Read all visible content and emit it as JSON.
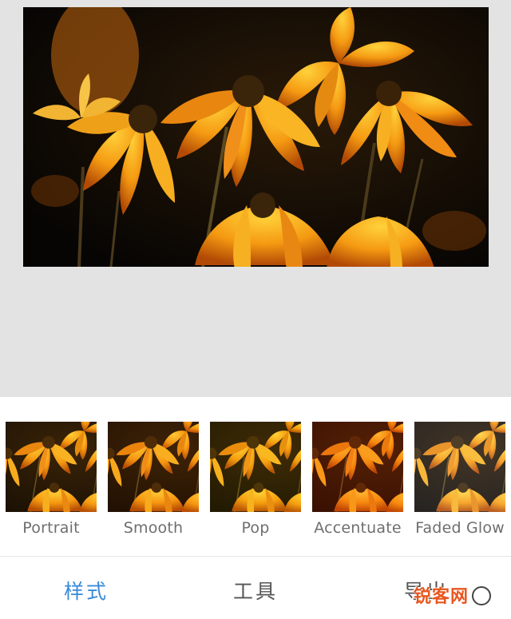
{
  "preview": {
    "subject": "flowers-photo"
  },
  "filters": [
    {
      "label": "Portrait",
      "tint": "#f29a18"
    },
    {
      "label": "Smooth",
      "tint": "#ee8c1a"
    },
    {
      "label": "Pop",
      "tint": "#f7a814"
    },
    {
      "label": "Accentuate",
      "tint": "#ef6a16"
    },
    {
      "label": "Faded Glow",
      "tint": "#e89a40"
    }
  ],
  "tabs": {
    "styles": "样式",
    "tools": "工具",
    "export": "导出"
  },
  "watermark": {
    "text": "锐客网"
  },
  "colors": {
    "active_tab": "#3a8ad8",
    "inactive_tab": "#555555",
    "preview_bg": "#e3e3e3"
  }
}
